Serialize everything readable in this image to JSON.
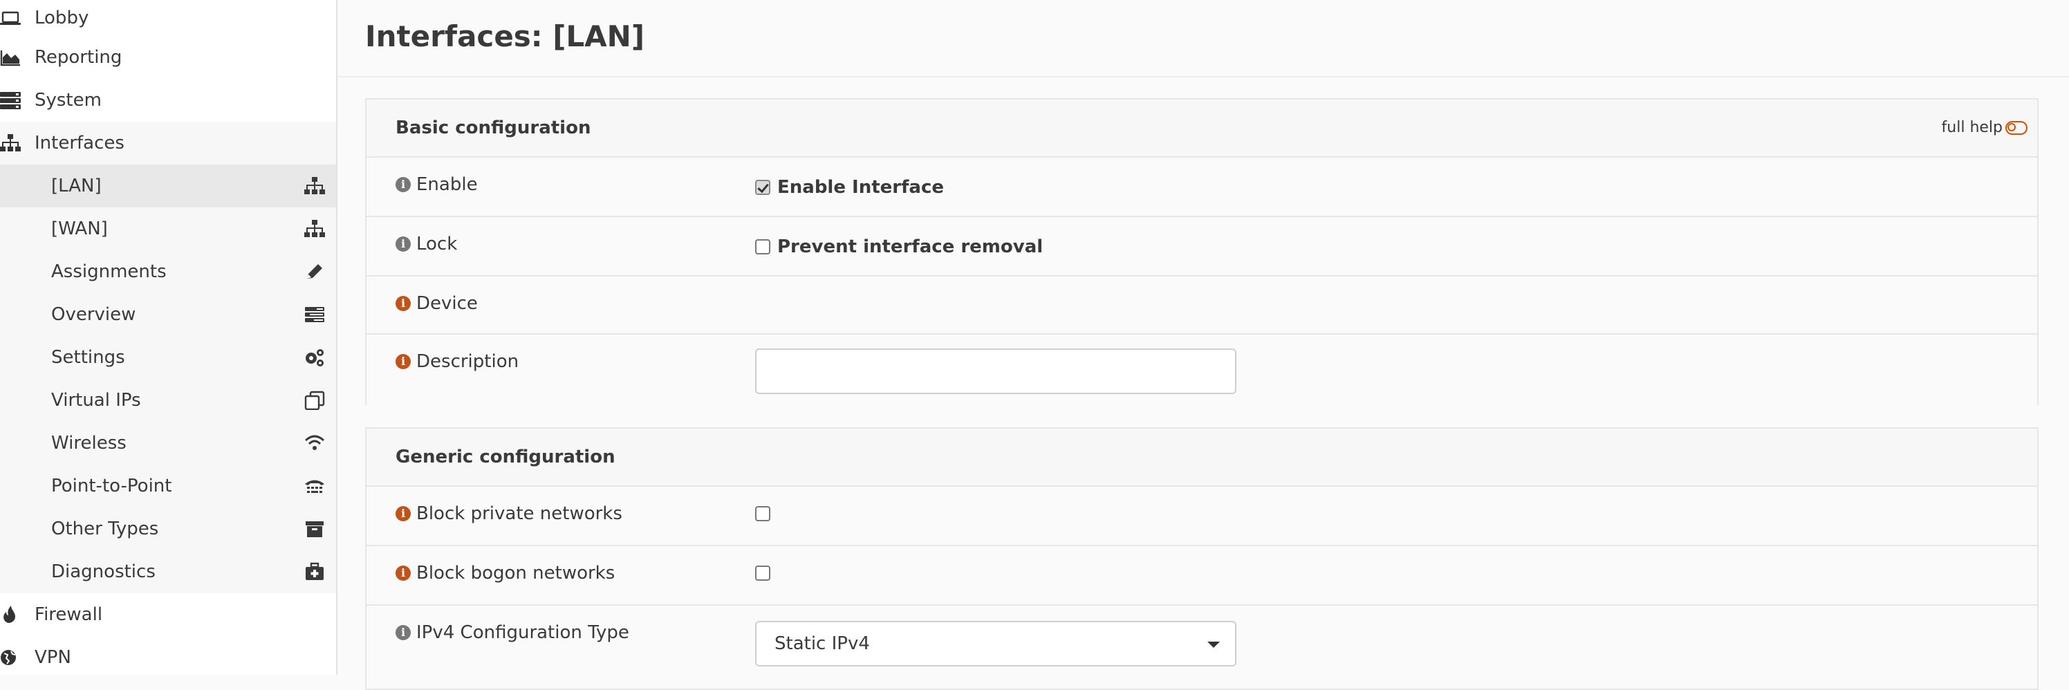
{
  "sidebar": {
    "top_items": [
      {
        "label": "Lobby",
        "icon": "laptop-icon"
      },
      {
        "label": "Reporting",
        "icon": "area-chart-icon"
      },
      {
        "label": "System",
        "icon": "server-icon"
      },
      {
        "label": "Interfaces",
        "icon": "sitemap-icon"
      }
    ],
    "interfaces_sub": [
      {
        "label": "[LAN]",
        "icon": "sitemap-icon"
      },
      {
        "label": "[WAN]",
        "icon": "sitemap-icon"
      },
      {
        "label": "Assignments",
        "icon": "pencil-icon"
      },
      {
        "label": "Overview",
        "icon": "tasks-icon"
      },
      {
        "label": "Settings",
        "icon": "cogs-icon"
      },
      {
        "label": "Virtual IPs",
        "icon": "clone-icon"
      },
      {
        "label": "Wireless",
        "icon": "wifi-icon"
      },
      {
        "label": "Point-to-Point",
        "icon": "tty-icon"
      },
      {
        "label": "Other Types",
        "icon": "archive-icon"
      },
      {
        "label": "Diagnostics",
        "icon": "medkit-icon"
      }
    ],
    "bottom_items": [
      {
        "label": "Firewall",
        "icon": "fire-icon"
      },
      {
        "label": "VPN",
        "icon": "globe-icon"
      }
    ]
  },
  "page": {
    "title": "Interfaces: [LAN]"
  },
  "basic": {
    "title": "Basic configuration",
    "full_help": "full help",
    "enable_label": "Enable",
    "enable_checkbox_label": "Enable Interface",
    "enable_checked": true,
    "lock_label": "Lock",
    "lock_checkbox_label": "Prevent interface removal",
    "lock_checked": false,
    "device_label": "Device",
    "description_label": "Description",
    "description_value": ""
  },
  "generic": {
    "title": "Generic configuration",
    "block_private_label": "Block private networks",
    "block_private_checked": false,
    "block_bogon_label": "Block bogon networks",
    "block_bogon_checked": false,
    "ipv4_type_label": "IPv4 Configuration Type",
    "ipv4_type_value": "Static IPv4"
  },
  "colors": {
    "accent": "#d94f00",
    "info_orange": "#c0531a",
    "info_grey": "#777777"
  }
}
